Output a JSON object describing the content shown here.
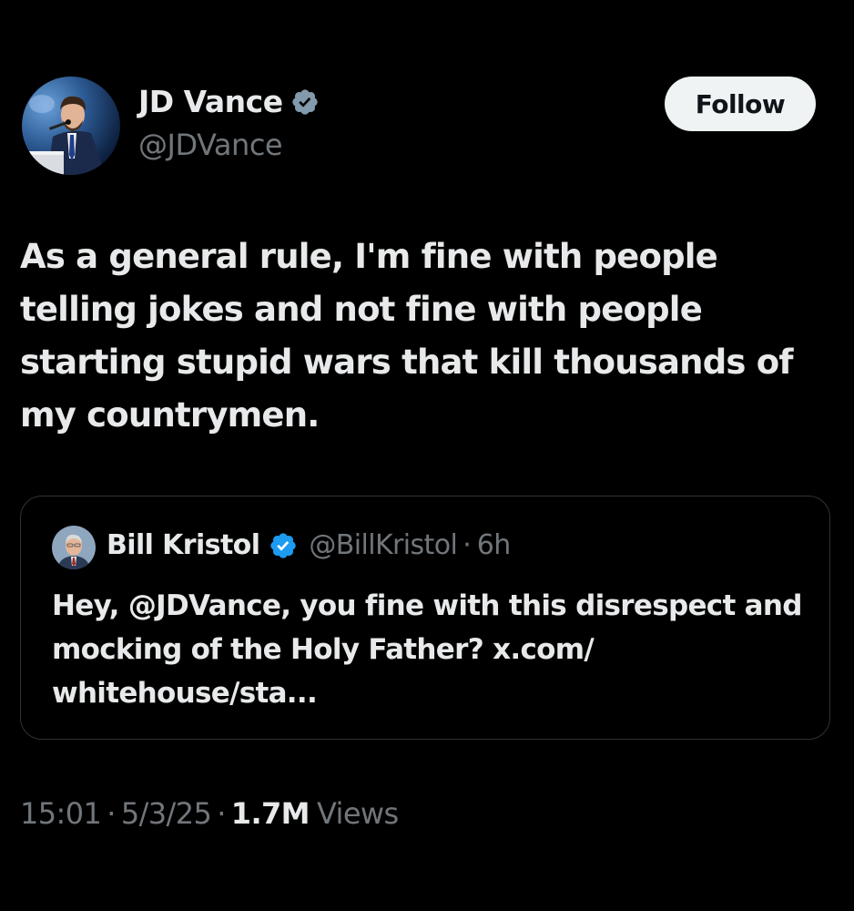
{
  "author": {
    "name": "JD Vance",
    "handle": "@JDVance",
    "avatar_icon": "person-speaking-at-podium-avatar",
    "verified_icon": "verified-badge-icon",
    "verified_color": "#829aab"
  },
  "follow_button": {
    "label": "Follow"
  },
  "tweet": {
    "text": "As a general rule, I'm fine with people telling jokes and not fine with people starting stupid wars that kill thousands of my countrymen."
  },
  "quote": {
    "name": "Bill Kristol",
    "handle": "@BillKristol",
    "separator": "·",
    "time": "6h",
    "text": "Hey, @JDVance, you fine with this disrespect and mocking of the Holy Father? x.com/ whitehouse/sta...",
    "avatar_icon": "man-portrait-avatar",
    "verified_icon": "verified-badge-icon",
    "verified_color": "#1d9bf0"
  },
  "meta": {
    "time": "15:01",
    "separator": "·",
    "date": "5/3/25",
    "views_count": "1.7M",
    "views_label": "Views"
  },
  "colors": {
    "background": "#000000",
    "primary_text": "#e7e9ea",
    "secondary_text": "#71767b",
    "border": "#2f3336",
    "follow_button_bg": "#eff3f4"
  }
}
